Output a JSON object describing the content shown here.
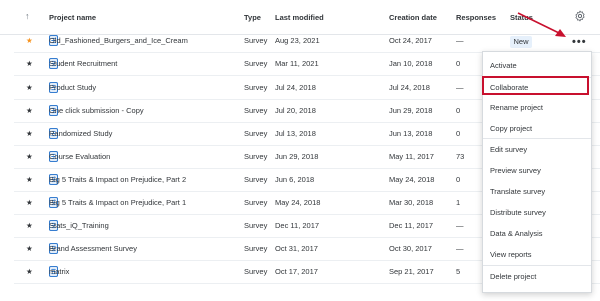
{
  "headers": {
    "sort": "↑",
    "project_name": "Project name",
    "type": "Type",
    "last_modified": "Last modified",
    "creation_date": "Creation date",
    "responses": "Responses",
    "status": "Status"
  },
  "rows": [
    {
      "name": "Old_Fashioned_Burgers_and_Ice_Cream",
      "type": "Survey",
      "modified": "Aug 23, 2021",
      "created": "Oct 24, 2017",
      "responses": "—",
      "status": "New",
      "starred": true
    },
    {
      "name": "Student Recruitment",
      "type": "Survey",
      "modified": "Mar 11, 2021",
      "created": "Jan 10, 2018",
      "responses": "0",
      "status": "",
      "starred": false
    },
    {
      "name": "Product Study",
      "type": "Survey",
      "modified": "Jul 24, 2018",
      "created": "Jul 24, 2018",
      "responses": "—",
      "status": "",
      "starred": false
    },
    {
      "name": "One click submission - Copy",
      "type": "Survey",
      "modified": "Jul 20, 2018",
      "created": "Jun 29, 2018",
      "responses": "0",
      "status": "",
      "starred": false
    },
    {
      "name": "Randomized Study",
      "type": "Survey",
      "modified": "Jul 13, 2018",
      "created": "Jun 13, 2018",
      "responses": "0",
      "status": "",
      "starred": false
    },
    {
      "name": "Course Evaluation",
      "type": "Survey",
      "modified": "Jun 29, 2018",
      "created": "May 11, 2017",
      "responses": "73",
      "status": "",
      "starred": false
    },
    {
      "name": "Big 5 Traits & Impact on Prejudice, Part 2",
      "type": "Survey",
      "modified": "Jun 6, 2018",
      "created": "May 24, 2018",
      "responses": "0",
      "status": "",
      "starred": false
    },
    {
      "name": "Big 5 Traits & Impact on Prejudice, Part 1",
      "type": "Survey",
      "modified": "May 24, 2018",
      "created": "Mar 30, 2018",
      "responses": "1",
      "status": "",
      "starred": false
    },
    {
      "name": "Stats_iQ_Training",
      "type": "Survey",
      "modified": "Dec 11, 2017",
      "created": "Dec 11, 2017",
      "responses": "—",
      "status": "",
      "starred": false
    },
    {
      "name": "Brand Assessment Survey",
      "type": "Survey",
      "modified": "Oct 31, 2017",
      "created": "Oct 30, 2017",
      "responses": "—",
      "status": "",
      "starred": false
    },
    {
      "name": "matrix",
      "type": "Survey",
      "modified": "Oct 17, 2017",
      "created": "Sep 21, 2017",
      "responses": "5",
      "status": "",
      "starred": false
    }
  ],
  "menu": {
    "activate": "Activate",
    "collaborate": "Collaborate",
    "rename": "Rename project",
    "copy": "Copy project",
    "edit": "Edit survey",
    "preview": "Preview survey",
    "translate": "Translate survey",
    "distribute": "Distribute survey",
    "data": "Data & Analysis",
    "reports": "View reports",
    "delete": "Delete project"
  },
  "more_icon": "•••",
  "colors": {
    "accent": "#c8102e",
    "star": "#f7931e",
    "survey_icon": "#1a6bc9",
    "badge_bg": "#e6f0fb"
  }
}
